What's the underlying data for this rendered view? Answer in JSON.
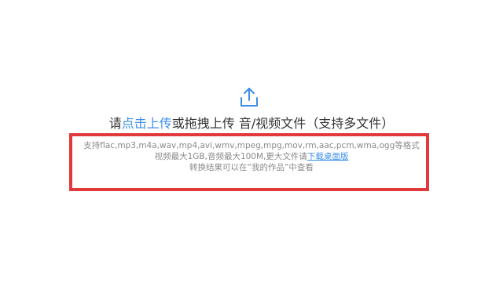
{
  "upload": {
    "icon": "upload-icon",
    "prefix": "请",
    "click_link": "点击上传",
    "suffix": "或拖拽上传 音/视频文件（支持多文件）"
  },
  "info": {
    "formats": "支持flac,mp3,m4a,wav,mp4,avi,wmv,mpeg,mpg,mov,rm,aac,pcm,wma,ogg等格式",
    "size_limits": "视频最大1GB,音频最大100M,更大文件请",
    "download_link": "下载桌面版",
    "result_note": "转换结果可以在“我的作品”中查看"
  },
  "colors": {
    "link": "#3b8ee9",
    "highlight_border": "#e23a3a",
    "text_main": "#333333",
    "text_muted": "#8a8a8a"
  }
}
